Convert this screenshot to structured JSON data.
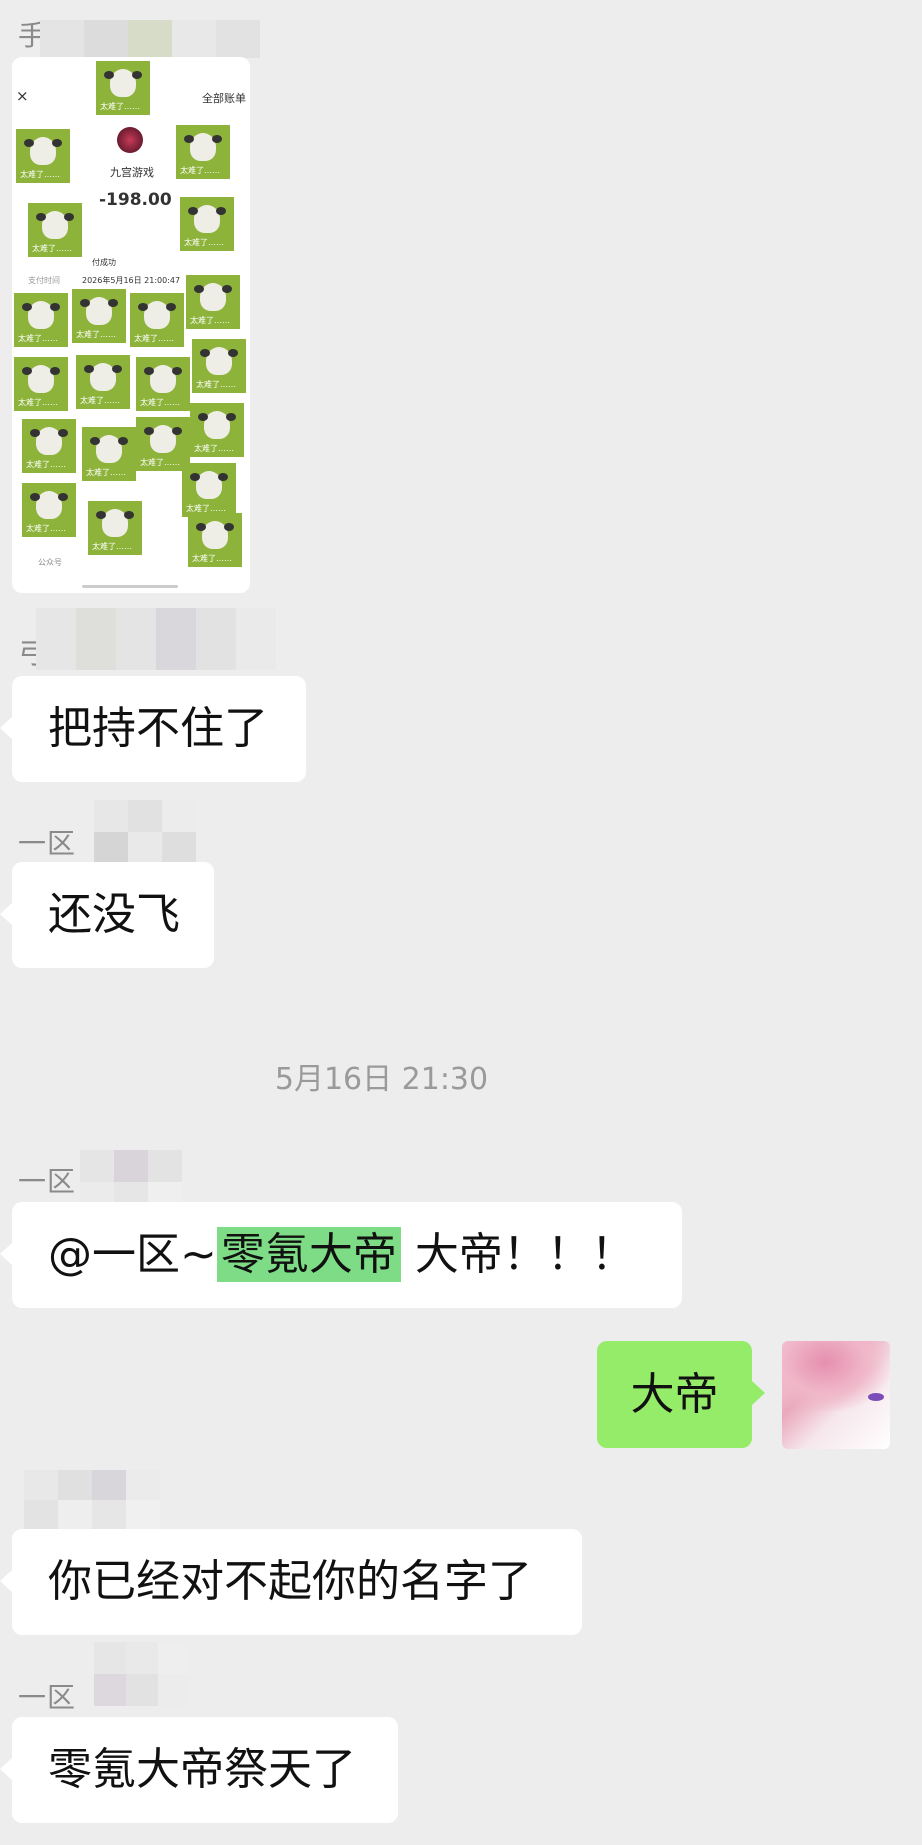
{
  "messages": [
    {
      "sender": "手枪",
      "type": "image"
    },
    {
      "sender": "弓",
      "text": "把持不住了"
    },
    {
      "sender": "一区",
      "text": "还没飞"
    },
    {
      "sender": "一区",
      "text_prefix": "@一区~",
      "mention": "零氪大帝",
      "text_suffix": " 大帝！！！"
    },
    {
      "sender": "",
      "text": "大帝",
      "is_me": true
    },
    {
      "sender": "",
      "text": "你已经对不起你的名字了"
    },
    {
      "sender": "一区",
      "text": "零氪大帝祭天了"
    }
  ],
  "timestamp": "5月16日 21:30",
  "shot": {
    "all_bills": "全部账单",
    "close": "×",
    "merchant": "九宫游戏",
    "amount": "-198.00",
    "status": "付成功",
    "pay_time_label": "支付时间",
    "pay_time": "2026年5月16日 21:00:47",
    "account": "公众号",
    "sticker_caption": "太难了……"
  },
  "colors": {
    "background": "#ededed",
    "my_bubble": "#95ec69",
    "other_bubble": "#ffffff",
    "mention_highlight": "#7ddc85"
  }
}
